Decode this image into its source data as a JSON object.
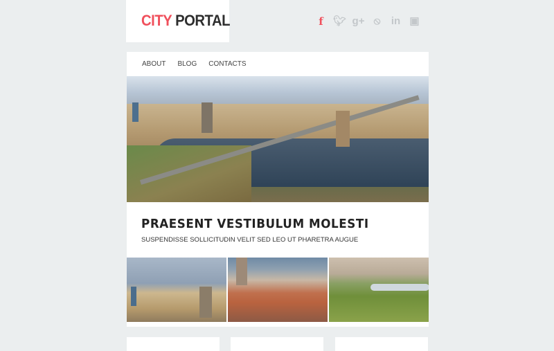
{
  "logo": {
    "part1": "CITY",
    "part2": "PORTAL"
  },
  "social": [
    {
      "name": "facebook-icon",
      "glyph": "f"
    },
    {
      "name": "twitter-icon",
      "glyph": "🐦"
    },
    {
      "name": "google-plus-icon",
      "glyph": "g+"
    },
    {
      "name": "rss-icon",
      "glyph": "◝"
    },
    {
      "name": "linkedin-icon",
      "glyph": "in"
    },
    {
      "name": "instagram-icon",
      "glyph": "▣"
    }
  ],
  "nav": {
    "items": [
      "ABOUT",
      "BLOG",
      "CONTACTS"
    ]
  },
  "hero": {
    "alt": "city skyline with river and bridge"
  },
  "headline": "PRAESENT VESTIBULUM MOLESTI",
  "subline": "SUSPENDISSE SOLLICITUDIN VELIT SED LEO UT PHARETRA AUGUE",
  "thumbnails": [
    "city skyline",
    "old town rooftops",
    "city park"
  ],
  "colors": {
    "accent": "#f0505c",
    "background": "#ebeeef",
    "text": "#222222"
  }
}
